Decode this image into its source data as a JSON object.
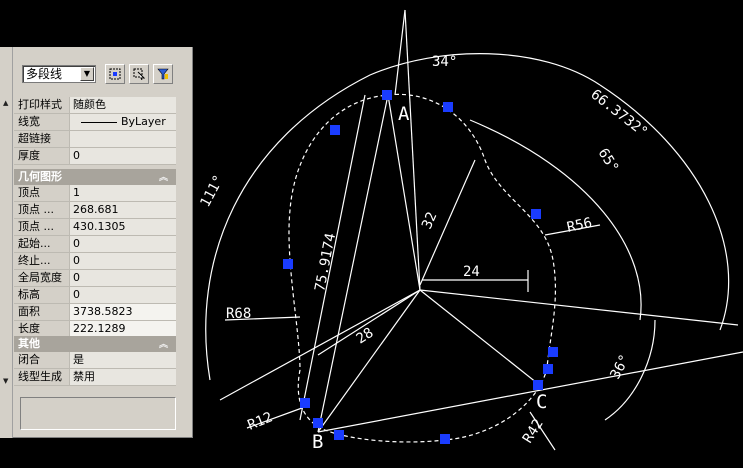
{
  "palette": {
    "object_type": "多段线",
    "buttons": [
      "quick-select",
      "select-objects",
      "filter"
    ],
    "general": [
      {
        "key": "打印样式",
        "value": "随颜色"
      },
      {
        "key": "线宽",
        "value": "ByLayer"
      },
      {
        "key": "超链接",
        "value": ""
      },
      {
        "key": "厚度",
        "value": "0"
      }
    ],
    "geometry_title": "几何图形",
    "geometry": [
      {
        "key": "顶点",
        "value": "1"
      },
      {
        "key": "顶点 ...",
        "value": "268.681"
      },
      {
        "key": "顶点 ...",
        "value": "430.1305"
      },
      {
        "key": "起始...",
        "value": "0"
      },
      {
        "key": "终止...",
        "value": "0"
      },
      {
        "key": "全局宽度",
        "value": "0"
      },
      {
        "key": "标高",
        "value": "0"
      },
      {
        "key": "面积",
        "value": "3738.5823"
      },
      {
        "key": "长度",
        "value": "222.1289"
      }
    ],
    "other_title": "其他",
    "other": [
      {
        "key": "闭合",
        "value": "是"
      },
      {
        "key": "线型生成",
        "value": "禁用"
      }
    ]
  },
  "drawing": {
    "dimensions": {
      "d34": "34°",
      "d66": "66.3732°",
      "d65": "65°",
      "d111": "111°",
      "d32": "32",
      "d75": "75.9174",
      "d24": "24",
      "r56": "R56",
      "r68": "R68",
      "d28": "28",
      "d36": "36°",
      "r12": "R12",
      "r42": "R42"
    },
    "point_labels": {
      "a": "A",
      "b": "B",
      "c": "C"
    },
    "colors": {
      "background": "#000000",
      "lines": "#ffffff",
      "grips": "#1a3cff"
    }
  }
}
